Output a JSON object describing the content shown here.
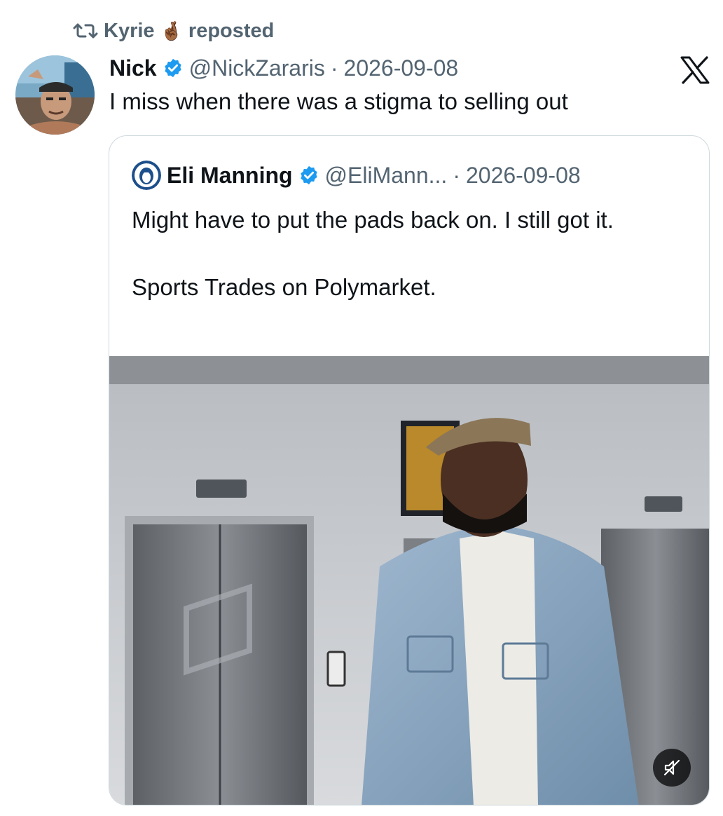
{
  "repost": {
    "user": "Kyrie",
    "emoji": "🤞🏾",
    "action": "reposted",
    "icon": "retweet-icon"
  },
  "post": {
    "author_name": "Nick",
    "handle": "@NickZararis",
    "separator": "·",
    "date": "2026-09-08",
    "text": "I miss when there was a stigma to selling out",
    "verified": true
  },
  "quoted_post": {
    "author_name": "Eli Manning",
    "handle": "@EliMann...",
    "separator": "·",
    "date": "2026-09-08",
    "text_line1": "Might have to put the pads back on. I still got it.",
    "text_line2": "Sports Trades on Polymarket.",
    "verified": true,
    "media": {
      "type": "video",
      "muted": true
    }
  },
  "colors": {
    "text_primary": "#0f1419",
    "text_secondary": "#536471",
    "verified_blue": "#1d9bf0",
    "border": "#cfd9de"
  }
}
